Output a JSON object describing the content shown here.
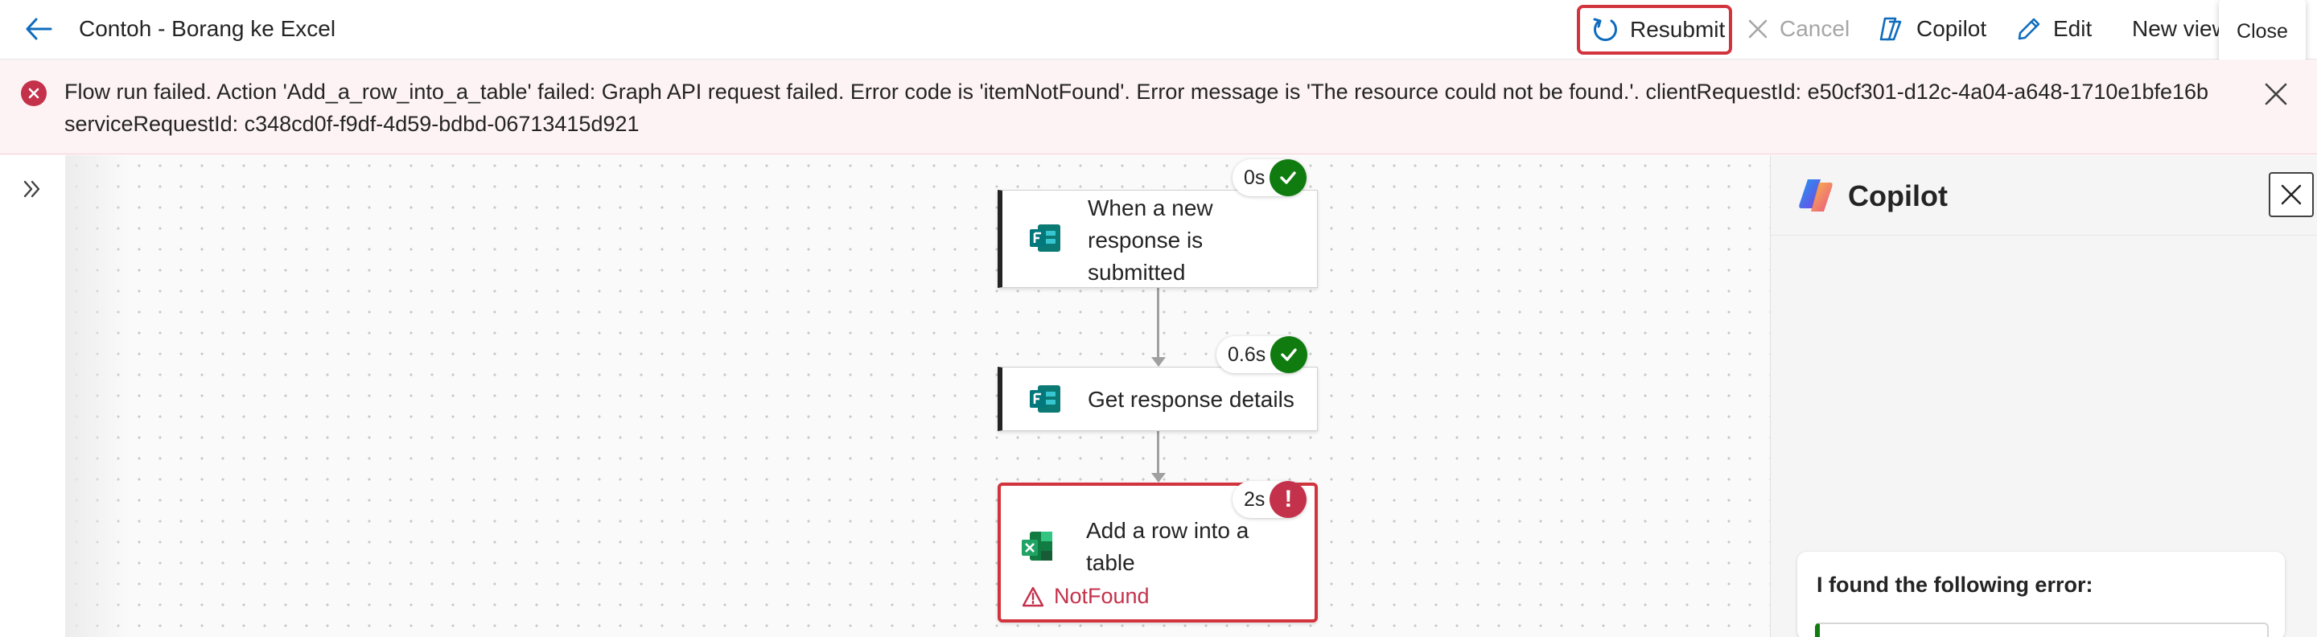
{
  "header": {
    "title": "Contoh - Borang ke Excel",
    "resubmit_label": "Resubmit",
    "cancel_label": "Cancel",
    "copilot_label": "Copilot",
    "edit_label": "Edit",
    "new_view_label": "New view",
    "close_tooltip": "Close"
  },
  "banner": {
    "message": "Flow run failed. Action 'Add_a_row_into_a_table' failed: Graph API request failed. Error code is 'itemNotFound'. Error message is 'The resource could not be found.'. clientRequestId: e50cf301-d12c-4a04-a648-1710e1bfe16b serviceRequestId: c348cd0f-f9df-4d59-bdbd-06713415d921",
    "icon": "error-circle-icon"
  },
  "flow": {
    "steps": [
      {
        "label": "When a new response is submitted",
        "duration": "0s",
        "status": "succeeded",
        "icon": "forms-icon"
      },
      {
        "label": "Get response details",
        "duration": "0.6s",
        "status": "succeeded",
        "icon": "forms-icon"
      },
      {
        "label": "Add a row into a table",
        "duration": "2s",
        "status": "failed",
        "icon": "excel-icon",
        "error": "NotFound"
      }
    ]
  },
  "copilot_panel": {
    "title": "Copilot",
    "message": "I found the following error:"
  },
  "colors": {
    "accent": "#0f6cbd",
    "error": "#c4314b",
    "highlight_border": "#d1343d",
    "success": "#107c10"
  }
}
